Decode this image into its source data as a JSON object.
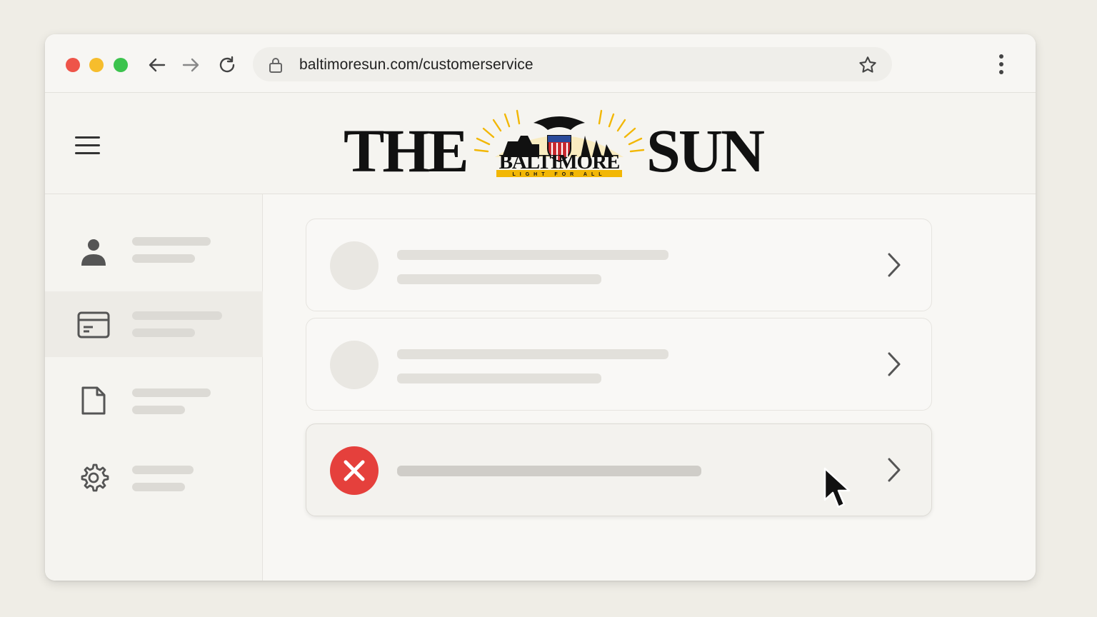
{
  "browser": {
    "url": "baltimoresun.com/customerservice",
    "icons": [
      "back-arrow-icon",
      "forward-arrow-icon",
      "reload-icon",
      "lock-icon",
      "star-icon",
      "kebab-menu-icon"
    ]
  },
  "site": {
    "logo_left": "THE",
    "logo_right": "SUN",
    "logo_emblem_text": "BALTIMORE",
    "logo_emblem_tagline": "LIGHT FOR ALL"
  },
  "sidebar": {
    "items": [
      {
        "icon": "person-icon",
        "active": false
      },
      {
        "icon": "credit-card-icon",
        "active": true
      },
      {
        "icon": "document-icon",
        "active": false
      },
      {
        "icon": "gear-icon",
        "active": false
      }
    ]
  },
  "content": {
    "cards": [
      {
        "state": "placeholder"
      },
      {
        "state": "placeholder"
      },
      {
        "state": "error",
        "icon": "error-x-icon"
      }
    ]
  },
  "colors": {
    "error": "#e5403c",
    "logo_gold": "#f2b705",
    "shield_red": "#c8262c",
    "shield_blue": "#2a4a9a"
  }
}
